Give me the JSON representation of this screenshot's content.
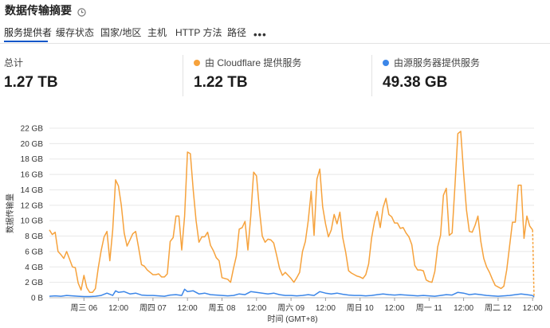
{
  "header": {
    "title": "数据传输摘要",
    "icon": "clock-icon"
  },
  "tabs": [
    {
      "label": "服务提供者",
      "active": true
    },
    {
      "label": "缓存状态"
    },
    {
      "label": "国家/地区"
    },
    {
      "label": "主机"
    },
    {
      "label": "HTTP 方法"
    },
    {
      "label": "路径"
    }
  ],
  "more_label": "•••",
  "stats": {
    "total": {
      "label": "总计",
      "value": "1.27 TB"
    },
    "cloudflare": {
      "label": "由 Cloudflare 提供服务",
      "value": "1.22 TB",
      "color": "#f6a23c"
    },
    "origin": {
      "label": "由源服务器提供服务",
      "value": "49.38 GB",
      "color": "#3b86e8"
    }
  },
  "chart_data": {
    "type": "line",
    "xlabel": "时间 (GMT+8)",
    "ylabel": "数据传输量",
    "ylim": [
      0,
      22
    ],
    "unit": "GB",
    "yticks": [
      "0 B",
      "2 GB",
      "4 GB",
      "6 GB",
      "8 GB",
      "10 GB",
      "12 GB",
      "14 GB",
      "16 GB",
      "18 GB",
      "20 GB",
      "22 GB"
    ],
    "x_range_hours": [
      0,
      168.5
    ],
    "xticks": [
      {
        "h": 12,
        "label": "周三 06"
      },
      {
        "h": 24,
        "label": "12:00"
      },
      {
        "h": 36,
        "label": "周四 07"
      },
      {
        "h": 48,
        "label": "12:00"
      },
      {
        "h": 60,
        "label": "周五 08"
      },
      {
        "h": 72,
        "label": "12:00"
      },
      {
        "h": 84,
        "label": "周六 09"
      },
      {
        "h": 96,
        "label": "12:00"
      },
      {
        "h": 108,
        "label": "周日 10"
      },
      {
        "h": 120,
        "label": "12:00"
      },
      {
        "h": 132,
        "label": "周一 11"
      },
      {
        "h": 144,
        "label": "12:00"
      },
      {
        "h": 156,
        "label": "周二 12"
      },
      {
        "h": 168,
        "label": "12:00"
      }
    ],
    "series": [
      {
        "color": "#f6a23c",
        "points": [
          [
            0,
            8.8
          ],
          [
            1,
            8.2
          ],
          [
            2,
            8.5
          ],
          [
            3,
            6.0
          ],
          [
            4,
            5.6
          ],
          [
            5,
            5.1
          ],
          [
            6,
            6.0
          ],
          [
            7,
            5.0
          ],
          [
            8,
            4.0
          ],
          [
            9,
            3.9
          ],
          [
            10,
            1.9
          ],
          [
            11,
            1.0
          ],
          [
            12,
            2.9
          ],
          [
            13,
            1.3
          ],
          [
            14,
            0.7
          ],
          [
            15,
            0.7
          ],
          [
            16,
            1.2
          ],
          [
            17,
            3.9
          ],
          [
            18,
            6.1
          ],
          [
            19,
            7.9
          ],
          [
            20,
            8.6
          ],
          [
            21,
            4.8
          ],
          [
            22,
            8.8
          ],
          [
            23,
            15.3
          ],
          [
            24,
            14.5
          ],
          [
            25,
            12.0
          ],
          [
            26,
            8.4
          ],
          [
            27,
            6.7
          ],
          [
            28,
            7.5
          ],
          [
            29,
            8.3
          ],
          [
            30,
            8.6
          ],
          [
            31,
            6.5
          ],
          [
            32,
            4.3
          ],
          [
            33,
            4.1
          ],
          [
            34,
            3.6
          ],
          [
            35,
            3.3
          ],
          [
            36,
            3.0
          ],
          [
            37,
            3.0
          ],
          [
            38,
            3.1
          ],
          [
            39,
            2.7
          ],
          [
            40,
            2.7
          ],
          [
            41,
            3.1
          ],
          [
            42,
            7.3
          ],
          [
            43,
            7.8
          ],
          [
            44,
            10.6
          ],
          [
            45,
            10.6
          ],
          [
            46,
            6.2
          ],
          [
            47,
            10.6
          ],
          [
            48,
            18.9
          ],
          [
            49,
            18.7
          ],
          [
            50,
            14.0
          ],
          [
            51,
            10.0
          ],
          [
            52,
            7.2
          ],
          [
            53,
            7.9
          ],
          [
            54,
            7.9
          ],
          [
            55,
            8.5
          ],
          [
            56,
            6.8
          ],
          [
            57,
            6.1
          ],
          [
            58,
            5.2
          ],
          [
            59,
            4.8
          ],
          [
            60,
            2.6
          ],
          [
            61,
            2.5
          ],
          [
            62,
            2.4
          ],
          [
            63,
            2.0
          ],
          [
            64,
            3.8
          ],
          [
            65,
            5.4
          ],
          [
            66,
            8.9
          ],
          [
            67,
            9.1
          ],
          [
            68,
            9.9
          ],
          [
            69,
            6.2
          ],
          [
            70,
            10.6
          ],
          [
            71,
            16.3
          ],
          [
            72,
            15.8
          ],
          [
            73,
            11.5
          ],
          [
            74,
            8.0
          ],
          [
            75,
            7.2
          ],
          [
            76,
            7.6
          ],
          [
            77,
            7.5
          ],
          [
            78,
            7.1
          ],
          [
            79,
            5.5
          ],
          [
            80,
            3.8
          ],
          [
            81,
            2.9
          ],
          [
            82,
            3.3
          ],
          [
            83,
            2.9
          ],
          [
            84,
            2.5
          ],
          [
            85,
            2.0
          ],
          [
            86,
            2.6
          ],
          [
            87,
            3.3
          ],
          [
            88,
            6.0
          ],
          [
            89,
            7.3
          ],
          [
            90,
            10.0
          ],
          [
            91,
            13.8
          ],
          [
            92,
            8.1
          ],
          [
            93,
            15.4
          ],
          [
            94,
            16.7
          ],
          [
            95,
            11.8
          ],
          [
            96,
            9.6
          ],
          [
            97,
            7.9
          ],
          [
            98,
            8.8
          ],
          [
            99,
            10.8
          ],
          [
            100,
            9.6
          ],
          [
            101,
            11.1
          ],
          [
            102,
            7.8
          ],
          [
            103,
            5.9
          ],
          [
            104,
            3.5
          ],
          [
            105,
            3.2
          ],
          [
            106,
            3.0
          ],
          [
            107,
            2.8
          ],
          [
            108,
            2.7
          ],
          [
            109,
            2.5
          ],
          [
            110,
            3.0
          ],
          [
            111,
            4.4
          ],
          [
            112,
            7.7
          ],
          [
            113,
            9.8
          ],
          [
            114,
            11.2
          ],
          [
            115,
            9.1
          ],
          [
            116,
            11.7
          ],
          [
            117,
            12.9
          ],
          [
            118,
            10.8
          ],
          [
            119,
            10.5
          ],
          [
            120,
            9.7
          ],
          [
            121,
            9.7
          ],
          [
            122,
            9.0
          ],
          [
            123,
            9.1
          ],
          [
            124,
            8.4
          ],
          [
            125,
            7.9
          ],
          [
            126,
            6.9
          ],
          [
            127,
            4.2
          ],
          [
            128,
            3.6
          ],
          [
            129,
            3.6
          ],
          [
            130,
            3.5
          ],
          [
            131,
            2.3
          ],
          [
            132,
            2.1
          ],
          [
            133,
            2.0
          ],
          [
            134,
            3.4
          ],
          [
            135,
            6.6
          ],
          [
            136,
            8.1
          ],
          [
            137,
            13.3
          ],
          [
            138,
            14.2
          ],
          [
            139,
            8.1
          ],
          [
            140,
            8.4
          ],
          [
            141,
            14.6
          ],
          [
            142,
            21.3
          ],
          [
            143,
            21.6
          ],
          [
            144,
            16.2
          ],
          [
            145,
            11.4
          ],
          [
            146,
            8.6
          ],
          [
            147,
            8.5
          ],
          [
            148,
            9.4
          ],
          [
            149,
            10.6
          ],
          [
            150,
            7.3
          ],
          [
            151,
            5.1
          ],
          [
            152,
            4.0
          ],
          [
            153,
            3.3
          ],
          [
            154,
            2.4
          ],
          [
            155,
            1.6
          ],
          [
            156,
            1.4
          ],
          [
            157,
            1.2
          ],
          [
            158,
            1.5
          ],
          [
            159,
            3.6
          ],
          [
            160,
            6.7
          ],
          [
            161,
            9.8
          ],
          [
            162,
            9.8
          ],
          [
            163,
            14.6
          ],
          [
            164,
            14.6
          ],
          [
            165,
            7.7
          ],
          [
            166,
            10.6
          ],
          [
            167,
            9.3
          ],
          [
            168,
            8.8
          ],
          [
            168.5,
            0.0
          ]
        ]
      },
      {
        "color": "#3b86e8",
        "points": [
          [
            0,
            0.2
          ],
          [
            2,
            0.25
          ],
          [
            4,
            0.2
          ],
          [
            6,
            0.3
          ],
          [
            8,
            0.25
          ],
          [
            10,
            0.2
          ],
          [
            12,
            0.15
          ],
          [
            14,
            0.15
          ],
          [
            16,
            0.2
          ],
          [
            18,
            0.3
          ],
          [
            20,
            0.6
          ],
          [
            22,
            0.3
          ],
          [
            23,
            0.9
          ],
          [
            24,
            0.7
          ],
          [
            26,
            0.8
          ],
          [
            28,
            0.5
          ],
          [
            30,
            0.6
          ],
          [
            32,
            0.35
          ],
          [
            34,
            0.3
          ],
          [
            36,
            0.3
          ],
          [
            38,
            0.25
          ],
          [
            40,
            0.2
          ],
          [
            42,
            0.35
          ],
          [
            44,
            0.4
          ],
          [
            46,
            0.3
          ],
          [
            47,
            1.1
          ],
          [
            48,
            0.8
          ],
          [
            50,
            0.9
          ],
          [
            52,
            0.5
          ],
          [
            54,
            0.6
          ],
          [
            56,
            0.4
          ],
          [
            58,
            0.35
          ],
          [
            60,
            0.3
          ],
          [
            62,
            0.25
          ],
          [
            64,
            0.3
          ],
          [
            66,
            0.5
          ],
          [
            68,
            0.4
          ],
          [
            70,
            0.8
          ],
          [
            72,
            0.7
          ],
          [
            74,
            0.6
          ],
          [
            76,
            0.5
          ],
          [
            78,
            0.6
          ],
          [
            80,
            0.4
          ],
          [
            82,
            0.3
          ],
          [
            84,
            0.3
          ],
          [
            86,
            0.25
          ],
          [
            88,
            0.3
          ],
          [
            90,
            0.4
          ],
          [
            92,
            0.3
          ],
          [
            94,
            0.8
          ],
          [
            96,
            0.6
          ],
          [
            98,
            0.5
          ],
          [
            100,
            0.6
          ],
          [
            102,
            0.45
          ],
          [
            104,
            0.35
          ],
          [
            106,
            0.3
          ],
          [
            108,
            0.3
          ],
          [
            110,
            0.25
          ],
          [
            112,
            0.3
          ],
          [
            114,
            0.4
          ],
          [
            116,
            0.5
          ],
          [
            118,
            0.4
          ],
          [
            120,
            0.35
          ],
          [
            122,
            0.4
          ],
          [
            124,
            0.35
          ],
          [
            126,
            0.3
          ],
          [
            128,
            0.25
          ],
          [
            130,
            0.3
          ],
          [
            132,
            0.25
          ],
          [
            134,
            0.2
          ],
          [
            136,
            0.3
          ],
          [
            138,
            0.4
          ],
          [
            140,
            0.35
          ],
          [
            142,
            0.7
          ],
          [
            144,
            0.6
          ],
          [
            146,
            0.4
          ],
          [
            148,
            0.5
          ],
          [
            150,
            0.4
          ],
          [
            152,
            0.3
          ],
          [
            154,
            0.25
          ],
          [
            156,
            0.2
          ],
          [
            158,
            0.25
          ],
          [
            160,
            0.3
          ],
          [
            162,
            0.4
          ],
          [
            164,
            0.5
          ],
          [
            166,
            0.4
          ],
          [
            168,
            0.3
          ],
          [
            168.5,
            0.1
          ]
        ]
      }
    ]
  }
}
